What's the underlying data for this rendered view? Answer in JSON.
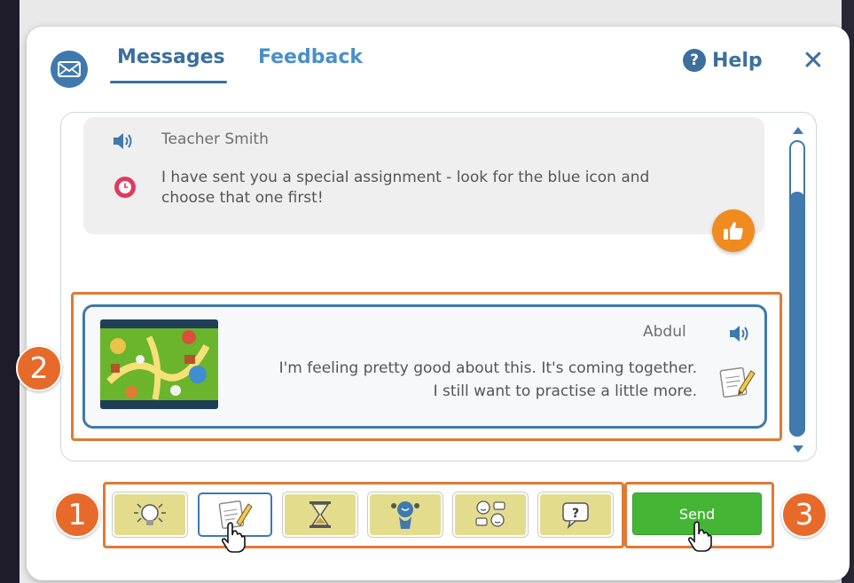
{
  "header": {
    "tabs": [
      {
        "label": "Messages",
        "active": true
      },
      {
        "label": "Feedback",
        "active": false
      }
    ],
    "help_label": "Help",
    "help_icon_glyph": "?",
    "close_glyph": "✕"
  },
  "messages": {
    "teacher": {
      "name": "Teacher Smith",
      "text": "I have sent you a special assignment - look for the blue icon and choose that one first!"
    },
    "student": {
      "name": "Abdul",
      "line1": "I'm feeling pretty good about this. It's coming together.",
      "line2": "I still want to practise a little more."
    }
  },
  "toolbar": {
    "buttons": [
      {
        "icon": "lightbulb-icon",
        "selected": false
      },
      {
        "icon": "notepad-pencil-icon",
        "selected": true
      },
      {
        "icon": "hourglass-icon",
        "selected": false
      },
      {
        "icon": "thinking-head-icon",
        "selected": false
      },
      {
        "icon": "faces-icon",
        "selected": false
      },
      {
        "icon": "question-bubble-icon",
        "selected": false
      }
    ],
    "send_label": "Send"
  },
  "annotations": {
    "badge_1": "1",
    "badge_2": "2",
    "badge_3": "3"
  },
  "colors": {
    "brand_blue": "#3f79ad",
    "highlight_orange": "#e07a34",
    "badge_orange": "#e86a2a",
    "send_green": "#45b536",
    "toolbar_yellow": "#e3dc8d"
  }
}
